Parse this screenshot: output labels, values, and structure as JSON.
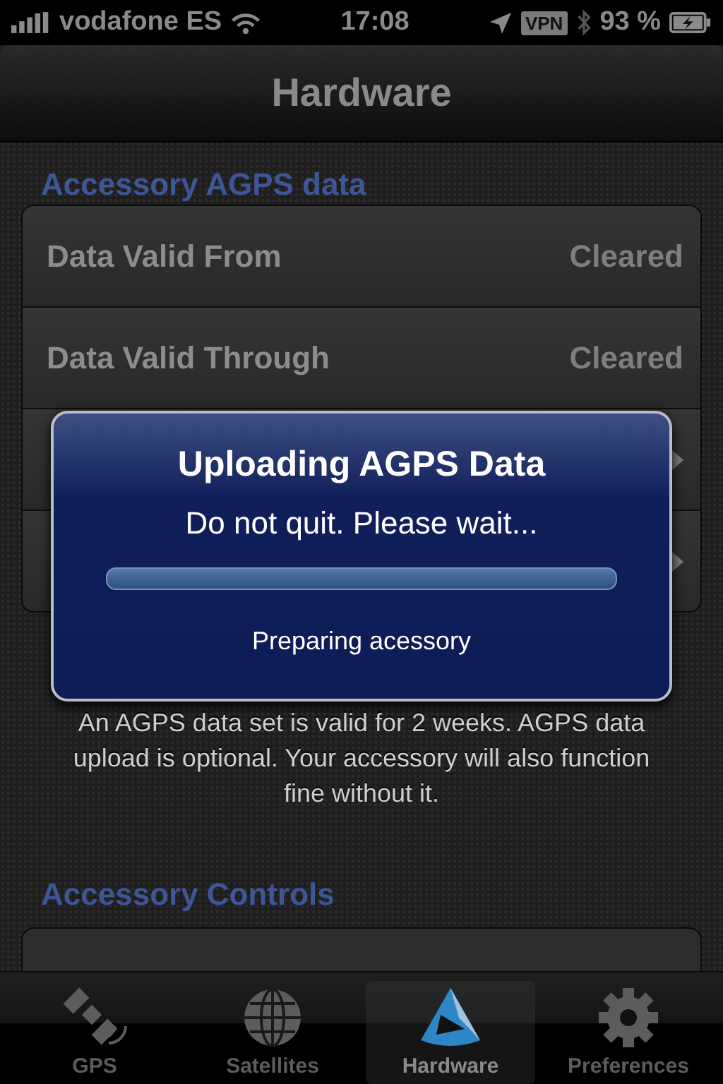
{
  "status_bar": {
    "carrier": "vodafone ES",
    "time": "17:08",
    "vpn": "VPN",
    "battery": "93 %"
  },
  "nav_bar": {
    "title": "Hardware"
  },
  "sections": [
    {
      "header": "Accessory AGPS data",
      "rows": [
        {
          "label": "Data Valid From",
          "value": "Cleared",
          "disclosure": false
        },
        {
          "label": "Data Valid Through",
          "value": "Cleared",
          "disclosure": false
        },
        {
          "disclosure": true
        },
        {
          "disclosure": true
        }
      ],
      "footer": "An AGPS data set is valid for 2 weeks. AGPS data upload is optional. Your accessory will also function fine without it."
    },
    {
      "header": "Accessory Controls"
    }
  ],
  "alert": {
    "title": "Uploading AGPS Data",
    "message": "Do not quit. Please wait...",
    "progress": {
      "level": 0
    },
    "status": "Preparing acessory"
  },
  "tabs": [
    {
      "label": "GPS",
      "kind": "satellite",
      "selected": false
    },
    {
      "label": "Satellites",
      "kind": "globe",
      "selected": false
    },
    {
      "label": "Hardware",
      "kind": "logo",
      "selected": true
    },
    {
      "label": "Preferences",
      "kind": "gear",
      "selected": false
    }
  ]
}
